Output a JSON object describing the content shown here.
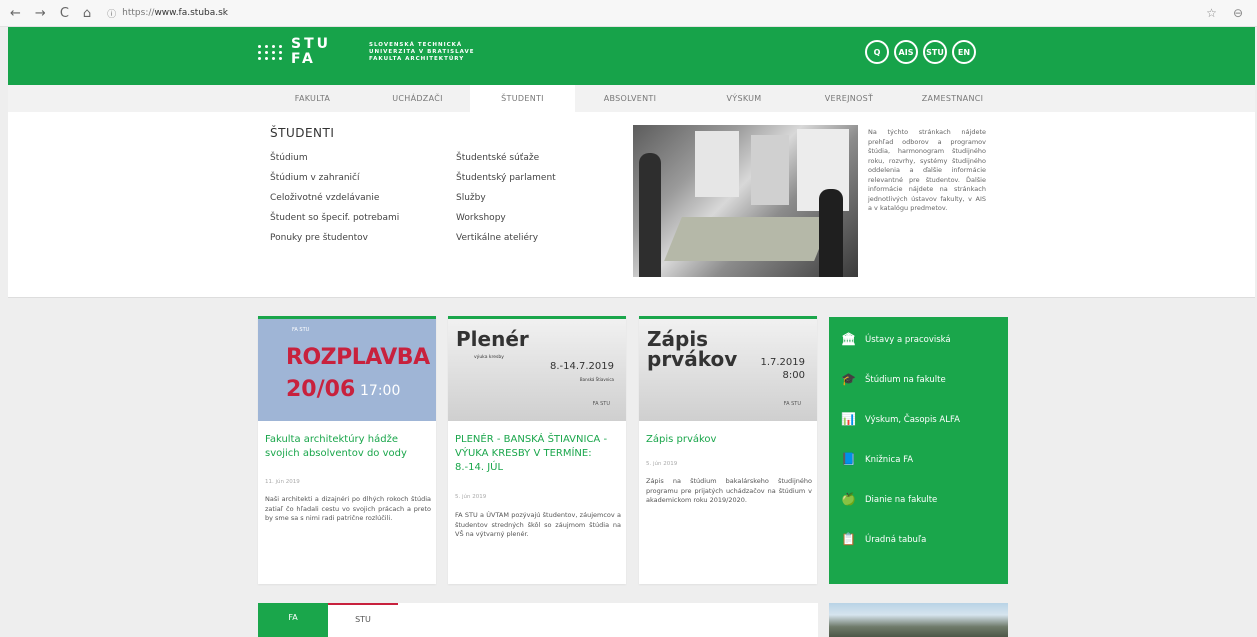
{
  "browser": {
    "back": "←",
    "forward": "→",
    "reload": "C",
    "home": "⌂",
    "url_scheme": "https://",
    "url_host": "www.fa.stuba.sk",
    "star": "☆",
    "account": "⊖"
  },
  "header": {
    "logo_line1": "STU",
    "logo_line2": "FA",
    "sub1": "Slovenská technická",
    "sub2": "univerzita v Bratislave",
    "sub3": "Fakulta architektúry",
    "icons": [
      "Q",
      "AIS",
      "STU",
      "EN"
    ]
  },
  "menu": {
    "items": [
      "FAKULTA",
      "UCHÁDZAČI",
      "ŠTUDENTI",
      "ABSOLVENTI",
      "VÝSKUM",
      "VEREJNOSŤ",
      "ZAMESTNANCI"
    ],
    "active": "ŠTUDENTI"
  },
  "dropdown": {
    "title": "ŠTUDENTI",
    "col1": [
      "Štúdium",
      "Štúdium v zahraničí",
      "Celoživotné vzdelávanie",
      "Študent so špecif. potrebami",
      "Ponuky pre študentov"
    ],
    "col2": [
      "Študentské súťaže",
      "Študentský parlament",
      "Služby",
      "Workshopy",
      "Vertikálne ateliéry"
    ],
    "description": "Na týchto stránkach nájdete prehľad odborov a programov štúdia, harmonogram študijného roku, rozvrhy, systémy študijného oddelenia a ďalšie informácie relevantné pre študentov. Ďalšie informácie nájdete na stránkach jednotlivých ústavov fakulty, v AIS a v katalógu predmetov."
  },
  "cards": [
    {
      "thumb_small": "FA STU",
      "thumb_big": "ROZPLAVBA",
      "thumb_date": "20/06",
      "thumb_time": "17:00",
      "title": "Fakulta architektúry hádže svojich absolventov do vody",
      "date": "11. jún 2019",
      "text": "Naši architekti a dizajnéri po dlhých rokoch štúdia zatiaľ čo hľadali cestu vo svojich prácach a preto by sme sa s nimi radi patrične rozlúčili."
    },
    {
      "thumb_title": "Plenér",
      "thumb_sub": "výuka kresby",
      "thumb_date": "8.-14.7.2019",
      "thumb_place": "Banská Štiavnica",
      "thumb_mark": "FA STU",
      "title": "PLENÉR - BANSKÁ ŠTIAVNICA - VÝUKA KRESBY V TERMÍNE: 8.-14. JÚL",
      "date": "5. jún 2019",
      "text": "FA STU a ÚVTAM pozývajú študentov, záujemcov a študentov stredných škôl so záujmom štúdia na VŠ na výtvarný plenér."
    },
    {
      "thumb_title": "Zápis prvákov",
      "thumb_date": "1.7.2019",
      "thumb_time": "8:00",
      "thumb_mark": "FA STU",
      "title": "Zápis prvákov",
      "date": "5. jún 2019",
      "text": "Zápis na štúdium bakalárskeho študijného programu pre prijatých uchádzačov na štúdium v akademickom roku 2019/2020."
    }
  ],
  "links": [
    {
      "icon": "bank-icon",
      "glyph": "🏛",
      "label": "Ústavy a pracoviská"
    },
    {
      "icon": "graduation-cap-icon",
      "glyph": "🎓",
      "label": "Štúdium na fakulte"
    },
    {
      "icon": "chart-icon",
      "glyph": "📊",
      "label": "Výskum, Časopis ALFA"
    },
    {
      "icon": "book-icon",
      "glyph": "📘",
      "label": "Knižnica FA"
    },
    {
      "icon": "apple-icon",
      "glyph": "🍏",
      "label": "Dianie na fakulte"
    },
    {
      "icon": "board-icon",
      "glyph": "📋",
      "label": "Úradná tabuľa"
    }
  ],
  "tabs": [
    "FA",
    "STU"
  ],
  "colors": {
    "brand_green": "#17a34a",
    "accent_red": "#c8213d"
  }
}
